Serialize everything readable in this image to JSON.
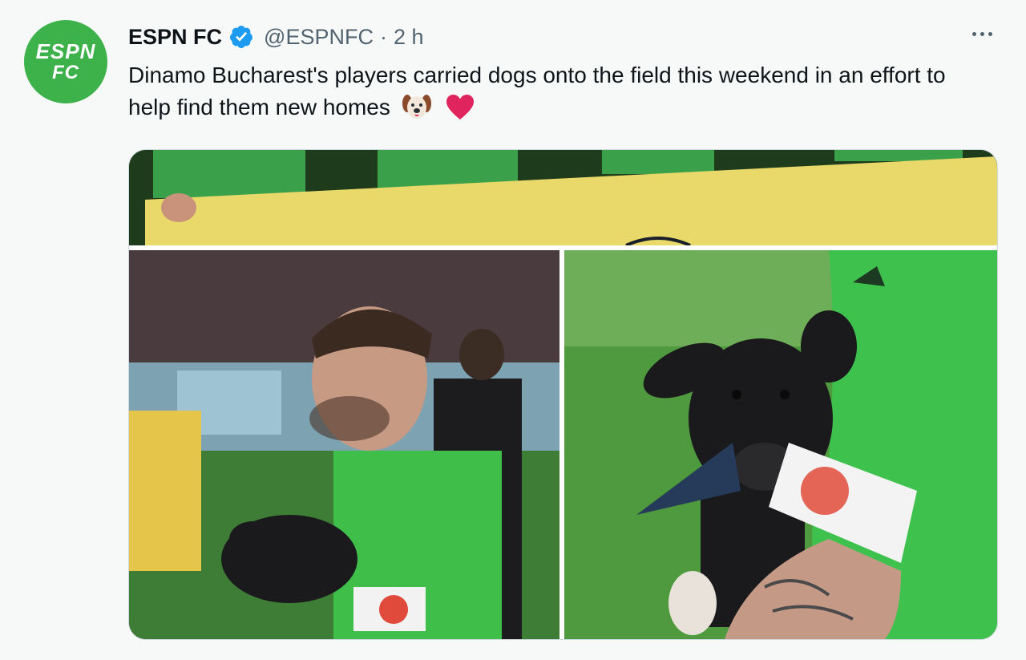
{
  "tweet": {
    "author_name": "ESPN FC",
    "handle": "@ESPNFC",
    "separator": "·",
    "time": "2 h",
    "text": "Dinamo Bucharest's players carried dogs onto the field this weekend in an effort to help find them new homes",
    "emojis": [
      "dog-face",
      "red-heart"
    ]
  },
  "avatar": {
    "line1": "ESPN",
    "line2": "FC",
    "color": "#3db14a"
  },
  "colors": {
    "verified": "#1d9bf0",
    "secondary_text": "#536471",
    "heart": "#e0245e"
  },
  "media": {
    "images": [
      "banner-players-holding-sign",
      "player-holding-black-puppy",
      "arm-holding-black-puppy-closeup"
    ]
  }
}
